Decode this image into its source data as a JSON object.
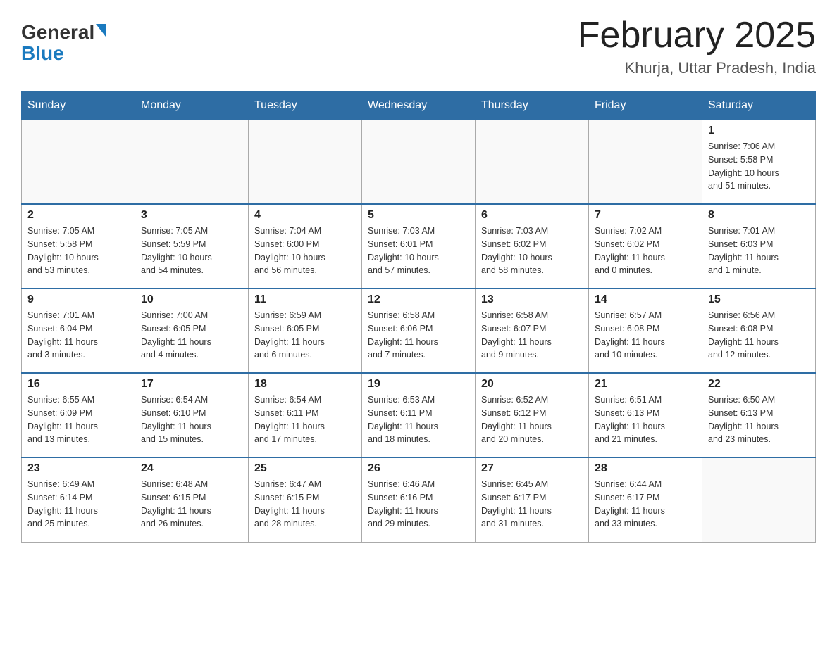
{
  "header": {
    "logo_general": "General",
    "logo_blue": "Blue",
    "month_title": "February 2025",
    "location": "Khurja, Uttar Pradesh, India"
  },
  "days_of_week": [
    "Sunday",
    "Monday",
    "Tuesday",
    "Wednesday",
    "Thursday",
    "Friday",
    "Saturday"
  ],
  "weeks": [
    [
      {
        "day": "",
        "info": ""
      },
      {
        "day": "",
        "info": ""
      },
      {
        "day": "",
        "info": ""
      },
      {
        "day": "",
        "info": ""
      },
      {
        "day": "",
        "info": ""
      },
      {
        "day": "",
        "info": ""
      },
      {
        "day": "1",
        "info": "Sunrise: 7:06 AM\nSunset: 5:58 PM\nDaylight: 10 hours\nand 51 minutes."
      }
    ],
    [
      {
        "day": "2",
        "info": "Sunrise: 7:05 AM\nSunset: 5:58 PM\nDaylight: 10 hours\nand 53 minutes."
      },
      {
        "day": "3",
        "info": "Sunrise: 7:05 AM\nSunset: 5:59 PM\nDaylight: 10 hours\nand 54 minutes."
      },
      {
        "day": "4",
        "info": "Sunrise: 7:04 AM\nSunset: 6:00 PM\nDaylight: 10 hours\nand 56 minutes."
      },
      {
        "day": "5",
        "info": "Sunrise: 7:03 AM\nSunset: 6:01 PM\nDaylight: 10 hours\nand 57 minutes."
      },
      {
        "day": "6",
        "info": "Sunrise: 7:03 AM\nSunset: 6:02 PM\nDaylight: 10 hours\nand 58 minutes."
      },
      {
        "day": "7",
        "info": "Sunrise: 7:02 AM\nSunset: 6:02 PM\nDaylight: 11 hours\nand 0 minutes."
      },
      {
        "day": "8",
        "info": "Sunrise: 7:01 AM\nSunset: 6:03 PM\nDaylight: 11 hours\nand 1 minute."
      }
    ],
    [
      {
        "day": "9",
        "info": "Sunrise: 7:01 AM\nSunset: 6:04 PM\nDaylight: 11 hours\nand 3 minutes."
      },
      {
        "day": "10",
        "info": "Sunrise: 7:00 AM\nSunset: 6:05 PM\nDaylight: 11 hours\nand 4 minutes."
      },
      {
        "day": "11",
        "info": "Sunrise: 6:59 AM\nSunset: 6:05 PM\nDaylight: 11 hours\nand 6 minutes."
      },
      {
        "day": "12",
        "info": "Sunrise: 6:58 AM\nSunset: 6:06 PM\nDaylight: 11 hours\nand 7 minutes."
      },
      {
        "day": "13",
        "info": "Sunrise: 6:58 AM\nSunset: 6:07 PM\nDaylight: 11 hours\nand 9 minutes."
      },
      {
        "day": "14",
        "info": "Sunrise: 6:57 AM\nSunset: 6:08 PM\nDaylight: 11 hours\nand 10 minutes."
      },
      {
        "day": "15",
        "info": "Sunrise: 6:56 AM\nSunset: 6:08 PM\nDaylight: 11 hours\nand 12 minutes."
      }
    ],
    [
      {
        "day": "16",
        "info": "Sunrise: 6:55 AM\nSunset: 6:09 PM\nDaylight: 11 hours\nand 13 minutes."
      },
      {
        "day": "17",
        "info": "Sunrise: 6:54 AM\nSunset: 6:10 PM\nDaylight: 11 hours\nand 15 minutes."
      },
      {
        "day": "18",
        "info": "Sunrise: 6:54 AM\nSunset: 6:11 PM\nDaylight: 11 hours\nand 17 minutes."
      },
      {
        "day": "19",
        "info": "Sunrise: 6:53 AM\nSunset: 6:11 PM\nDaylight: 11 hours\nand 18 minutes."
      },
      {
        "day": "20",
        "info": "Sunrise: 6:52 AM\nSunset: 6:12 PM\nDaylight: 11 hours\nand 20 minutes."
      },
      {
        "day": "21",
        "info": "Sunrise: 6:51 AM\nSunset: 6:13 PM\nDaylight: 11 hours\nand 21 minutes."
      },
      {
        "day": "22",
        "info": "Sunrise: 6:50 AM\nSunset: 6:13 PM\nDaylight: 11 hours\nand 23 minutes."
      }
    ],
    [
      {
        "day": "23",
        "info": "Sunrise: 6:49 AM\nSunset: 6:14 PM\nDaylight: 11 hours\nand 25 minutes."
      },
      {
        "day": "24",
        "info": "Sunrise: 6:48 AM\nSunset: 6:15 PM\nDaylight: 11 hours\nand 26 minutes."
      },
      {
        "day": "25",
        "info": "Sunrise: 6:47 AM\nSunset: 6:15 PM\nDaylight: 11 hours\nand 28 minutes."
      },
      {
        "day": "26",
        "info": "Sunrise: 6:46 AM\nSunset: 6:16 PM\nDaylight: 11 hours\nand 29 minutes."
      },
      {
        "day": "27",
        "info": "Sunrise: 6:45 AM\nSunset: 6:17 PM\nDaylight: 11 hours\nand 31 minutes."
      },
      {
        "day": "28",
        "info": "Sunrise: 6:44 AM\nSunset: 6:17 PM\nDaylight: 11 hours\nand 33 minutes."
      },
      {
        "day": "",
        "info": ""
      }
    ]
  ]
}
